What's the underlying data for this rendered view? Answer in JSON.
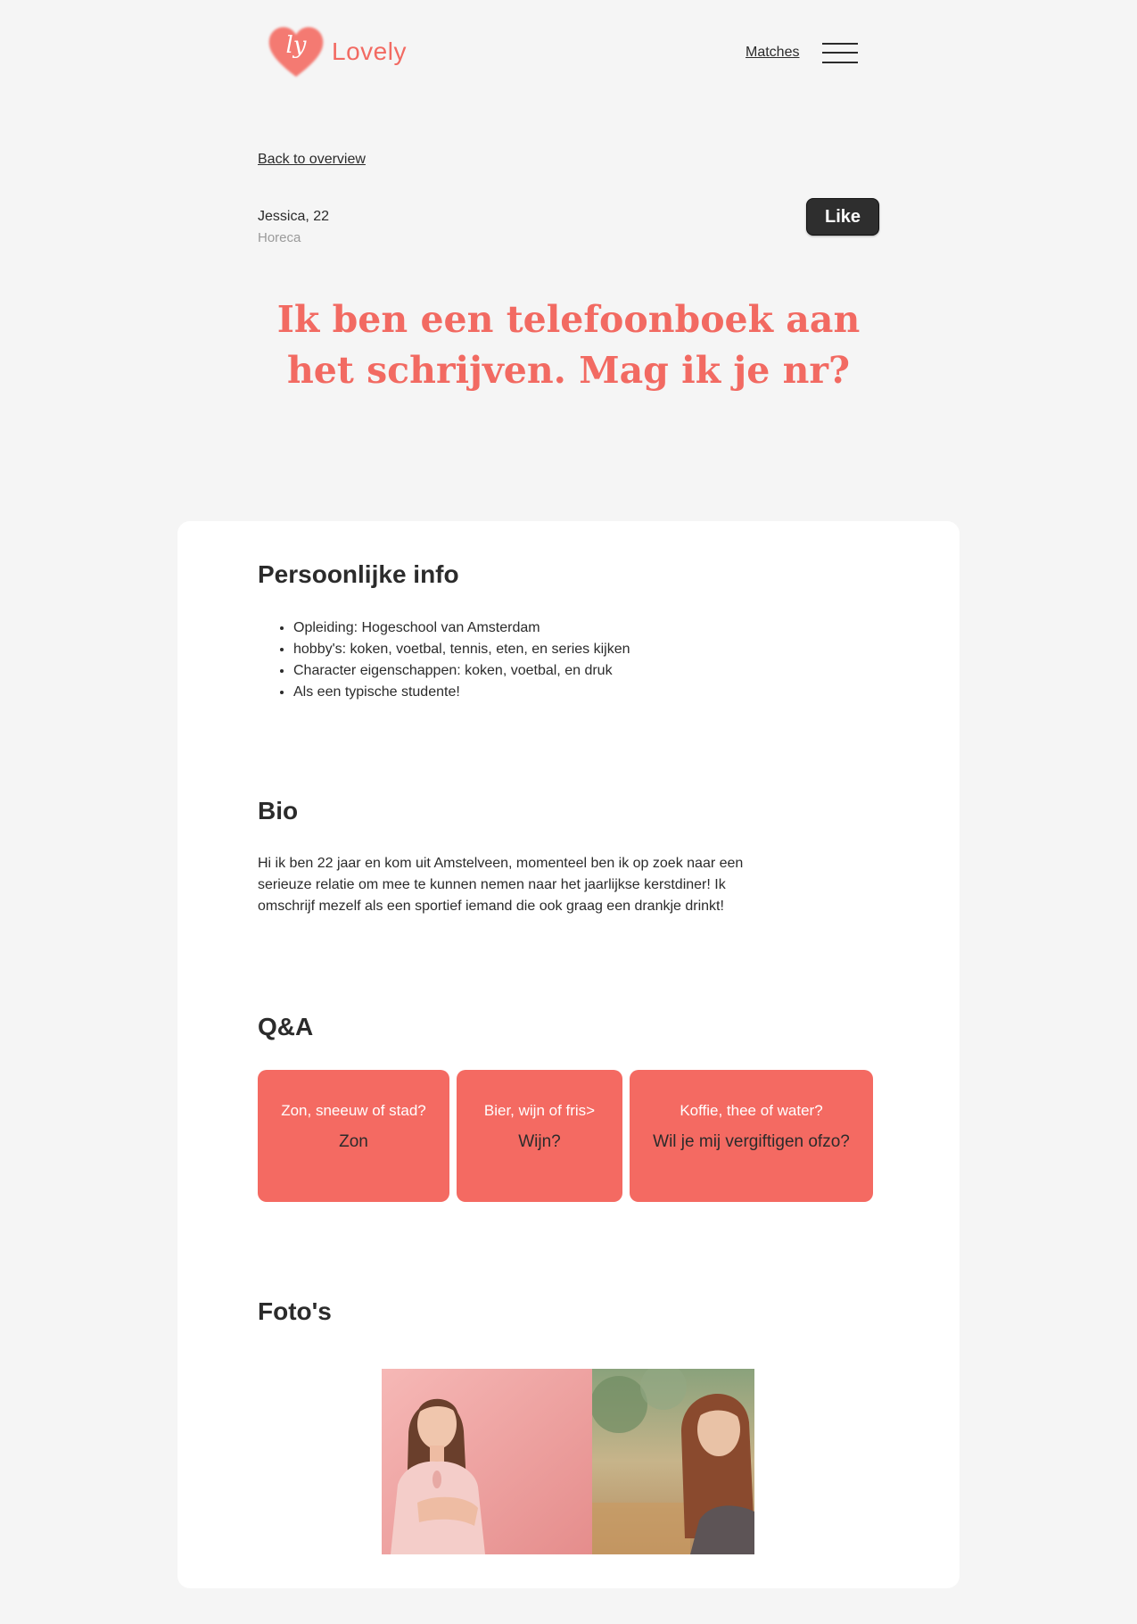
{
  "header": {
    "logo_mark": "ly",
    "logo_text": "Lovely",
    "nav_matches": "Matches",
    "menu_icon": "hamburger-menu-icon"
  },
  "profile": {
    "back_link": "Back to overview",
    "name_age": "Jessica, 22",
    "occupation": "Horeca",
    "like_label": "Like",
    "headline": "Ik ben een telefoonboek aan het schrijven. Mag ik je nr?"
  },
  "personal": {
    "title": "Persoonlijke info",
    "items": [
      "Opleiding: Hogeschool van Amsterdam",
      "hobby's: koken, voetbal, tennis, eten, en series kijken",
      "Character eigenschappen: koken, voetbal, en druk",
      "Als een typische studente!"
    ]
  },
  "bio": {
    "title": "Bio",
    "text": "Hi ik ben 22 jaar en kom uit Amstelveen, momenteel ben ik op zoek naar een serieuze relatie om mee te kunnen nemen naar het jaarlijkse kerstdiner! Ik omschrijf mezelf als een sportief iemand die ook graag een drankje drinkt!"
  },
  "qa": {
    "title": "Q&A",
    "cards": [
      {
        "question": "Zon, sneeuw of stad?",
        "answer": "Zon"
      },
      {
        "question": "Bier, wijn of fris>",
        "answer": "Wijn?"
      },
      {
        "question": "Koffie, thee of water?",
        "answer": "Wil je mij vergiftigen ofzo?"
      }
    ]
  },
  "photos": {
    "title": "Foto's"
  },
  "colors": {
    "accent": "#f26a62",
    "qa_card": "#f46a62",
    "background": "#f5f5f5",
    "card": "#ffffff",
    "button": "#2e2e2e"
  }
}
